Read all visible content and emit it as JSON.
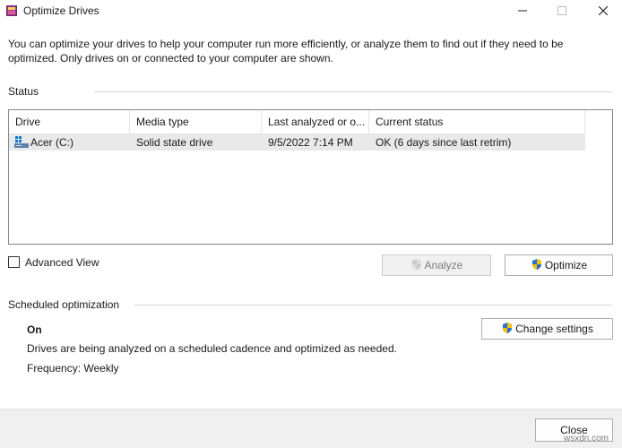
{
  "window": {
    "title": "Optimize Drives",
    "app_icon": "optimize-drives-icon",
    "controls": [
      "minimize-icon",
      "maximize-icon",
      "close-icon"
    ]
  },
  "description": "You can optimize your drives to help your computer run more efficiently, or analyze them to find out if they need to be optimized. Only drives on or connected to your computer are shown.",
  "status": {
    "label": "Status",
    "columns": [
      "Drive",
      "Media type",
      "Last analyzed or o...",
      "Current status"
    ],
    "rows": [
      {
        "drive": "Acer (C:)",
        "media_type": "Solid state drive",
        "last_analyzed": "9/5/2022 7:14 PM",
        "current_status": "OK (6 days since last retrim)",
        "icon": "drive-icon"
      }
    ]
  },
  "advanced_view": {
    "label": "Advanced View",
    "checked": false
  },
  "buttons": {
    "analyze": "Analyze",
    "optimize": "Optimize",
    "change_settings": "Change settings",
    "close": "Close"
  },
  "scheduled": {
    "label": "Scheduled optimization",
    "state": "On",
    "description": "Drives are being analyzed on a scheduled cadence and optimized as needed.",
    "frequency": "Frequency: Weekly"
  },
  "watermark": "wsxdn.com",
  "colors": {
    "selected_row": "#e9e9e9",
    "footer": "#f0f0f0",
    "shield_blue": "#2a6fd1",
    "shield_yellow": "#f2c200"
  }
}
